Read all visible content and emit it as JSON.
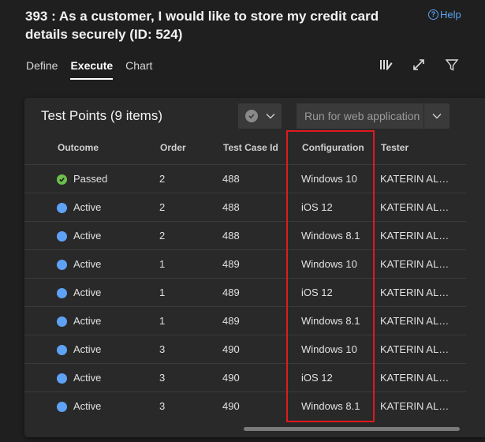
{
  "header": {
    "title": "393 : As a customer, I would like to store my credit card details securely (ID: 524)",
    "help_label": "Help"
  },
  "tabs": [
    {
      "label": "Define",
      "active": false
    },
    {
      "label": "Execute",
      "active": true
    },
    {
      "label": "Chart",
      "active": false
    }
  ],
  "toolbar": {
    "icons": [
      "column-options-icon",
      "expand-icon",
      "filter-icon"
    ]
  },
  "panel": {
    "title": "Test Points (9 items)",
    "run_button_label": "Run for web application",
    "columns": [
      "Outcome",
      "Order",
      "Test Case Id",
      "Configuration",
      "Tester"
    ],
    "rows": [
      {
        "outcome": "Passed",
        "order": "2",
        "test_case_id": "488",
        "configuration": "Windows 10",
        "tester": "KATERIN ALME..."
      },
      {
        "outcome": "Active",
        "order": "2",
        "test_case_id": "488",
        "configuration": "iOS 12",
        "tester": "KATERIN ALME..."
      },
      {
        "outcome": "Active",
        "order": "2",
        "test_case_id": "488",
        "configuration": "Windows 8.1",
        "tester": "KATERIN ALME..."
      },
      {
        "outcome": "Active",
        "order": "1",
        "test_case_id": "489",
        "configuration": "Windows 10",
        "tester": "KATERIN ALME..."
      },
      {
        "outcome": "Active",
        "order": "1",
        "test_case_id": "489",
        "configuration": "iOS 12",
        "tester": "KATERIN ALME..."
      },
      {
        "outcome": "Active",
        "order": "1",
        "test_case_id": "489",
        "configuration": "Windows 8.1",
        "tester": "KATERIN ALME..."
      },
      {
        "outcome": "Active",
        "order": "3",
        "test_case_id": "490",
        "configuration": "Windows 10",
        "tester": "KATERIN ALME..."
      },
      {
        "outcome": "Active",
        "order": "3",
        "test_case_id": "490",
        "configuration": "iOS 12",
        "tester": "KATERIN ALME..."
      },
      {
        "outcome": "Active",
        "order": "3",
        "test_case_id": "490",
        "configuration": "Windows 8.1",
        "tester": "KATERIN ALME..."
      }
    ]
  },
  "colors": {
    "background": "#1f1f1f",
    "panel": "#292929",
    "accent_link": "#5aa3f0",
    "passed": "#6cbf4b",
    "active": "#5ea2f5",
    "highlight": "#e0191f"
  }
}
